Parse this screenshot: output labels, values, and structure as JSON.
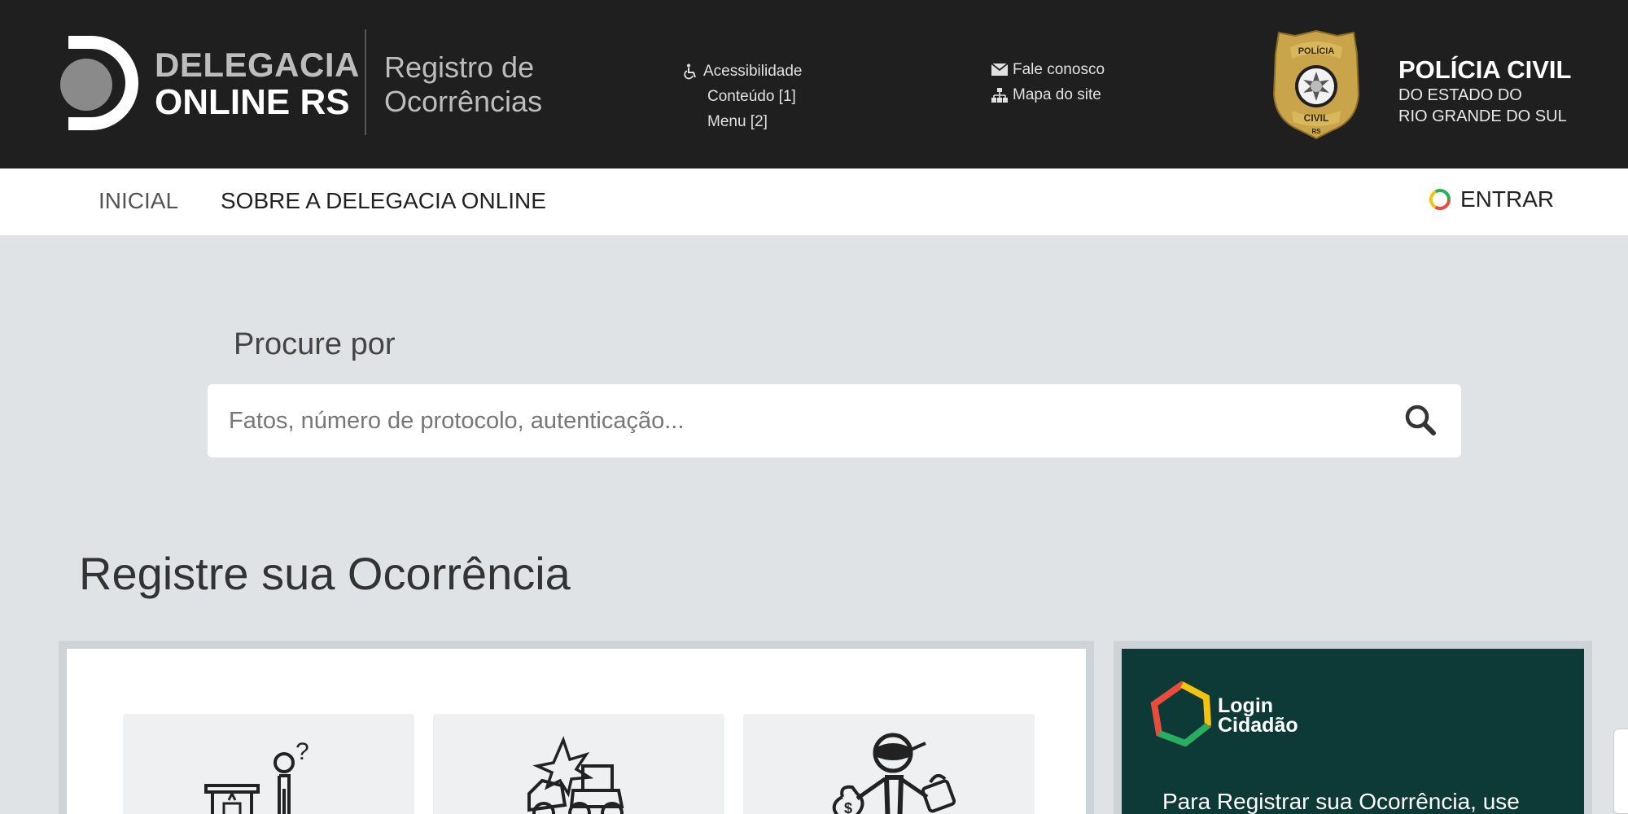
{
  "header": {
    "logo_line1": "DELEGACIA",
    "logo_line2": "ONLINE RS",
    "registro_line1": "Registro de",
    "registro_line2": "Ocorrências",
    "accessibility": "Acessibilidade",
    "conteudo": "Conteúdo [1]",
    "menu": "Menu [2]",
    "fale_conosco": "Fale conosco",
    "mapa_site": "Mapa do site",
    "badge_top": "POLÍCIA",
    "badge_bottom": "CIVIL",
    "badge_rs": "RS",
    "policia_line1": "POLÍCIA CIVIL",
    "policia_line2": "DO ESTADO DO",
    "policia_line3": "RIO GRANDE DO SUL"
  },
  "nav": {
    "inicial": "INICIAL",
    "sobre": "SOBRE A DELEGACIA ONLINE",
    "entrar": "ENTRAR"
  },
  "search": {
    "label": "Procure por",
    "placeholder": "Fatos, número de protocolo, autenticação..."
  },
  "section": {
    "title": "Registre sua Ocorrência"
  },
  "login": {
    "title_line1": "Login",
    "title_line2": "Cidadão",
    "text": "Para Registrar sua Ocorrência, use"
  },
  "icons": {
    "accessibility": "wheelchair-icon",
    "mail": "envelope-icon",
    "sitemap": "sitemap-icon",
    "search": "search-icon",
    "login": "login-cidadao-logo-icon"
  },
  "colors": {
    "header_bg": "#1f1f1f",
    "page_bg": "#dfe3e5",
    "login_bg": "#0d3a36",
    "badge_gold": "#c9a44a"
  }
}
